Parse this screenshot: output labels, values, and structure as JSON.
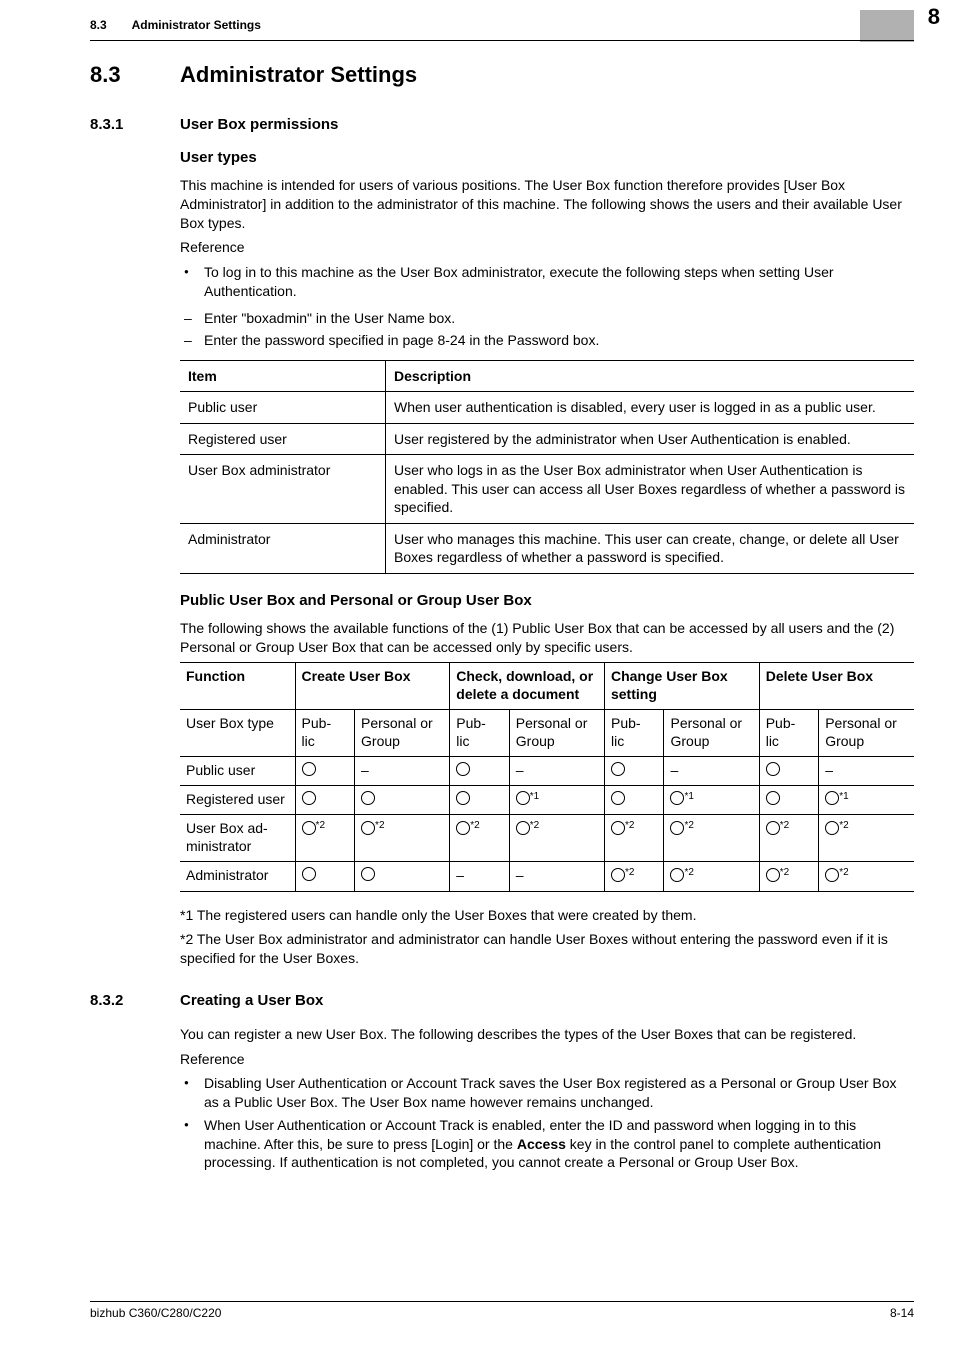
{
  "header": {
    "section_num": "8.3",
    "section_title": "Administrator Settings"
  },
  "chapter": "8",
  "h1": {
    "num": "8.3",
    "title": "Administrator Settings"
  },
  "s1": {
    "num": "8.3.1",
    "title": "User Box permissions",
    "h3a": "User types",
    "intro": "This machine is intended for users of various positions. The User Box function therefore provides [User Box Administrator] in addition to the administrator of this machine. The following shows the users and their available User Box types.",
    "ref_label": "Reference",
    "bullet1": "To log in to this machine as the User Box administrator, execute the following steps when setting User Authentication.",
    "dash1": "Enter \"boxadmin\" in the User Name box.",
    "dash2": "Enter the password specified in page 8-24 in the Password box.",
    "t1_head": {
      "c1": "Item",
      "c2": "Description"
    },
    "t1_rows": [
      {
        "c1": "Public user",
        "c2": "When user authentication is disabled, every user is logged in as a public user."
      },
      {
        "c1": "Registered user",
        "c2": "User registered by the administrator when User Authentication is enabled."
      },
      {
        "c1": "User Box administrator",
        "c2": "User who logs in as the User Box administrator when User Authentication is enabled. This user can access all User Boxes regardless of whether a password is specified."
      },
      {
        "c1": "Administrator",
        "c2": "User who manages this machine. This user can create, change, or delete all User Boxes regardless of whether a password is specified."
      }
    ],
    "h3b": "Public User Box and Personal or Group User Box",
    "p2": "The following shows the available functions of the (1) Public User Box that can be accessed by all users and the (2) Personal or Group User Box that can be accessed only by specific users.",
    "t2_head": {
      "f": "Function",
      "g1": "Create User Box",
      "g2": "Check, download, or delete a document",
      "g3": "Change User Box setting",
      "g4": "Delete User Box",
      "sub_a": "Public",
      "sub_b": "Personal or Group"
    },
    "t2_rows": [
      {
        "c0": "User Box type",
        "pub": "Public",
        "pg": "Personal or Group"
      },
      {
        "c0": "Public user"
      },
      {
        "c0": "Registered user"
      },
      {
        "c0": "User Box administrator"
      },
      {
        "c0": "Administrator"
      }
    ],
    "note1": "*1 The registered users can handle only the User Boxes that were created by them.",
    "note2": "*2 The User Box administrator and administrator can handle User Boxes without entering the password even if it is specified for the User Boxes."
  },
  "s2": {
    "num": "8.3.2",
    "title": "Creating a User Box",
    "p1": "You can register a new User Box. The following describes the types of the User Boxes that can be registered.",
    "ref_label": "Reference",
    "b1": "Disabling User Authentication or Account Track saves the User Box registered as a Personal or Group User Box as a Public User Box. The User Box name however remains unchanged.",
    "b2_a": "When User Authentication or Account Track is enabled, enter the ID and password when logging in to this machine. After this, be sure to press [Login] or the ",
    "b2_bold": "Access",
    "b2_b": " key in the control panel to complete authentication processing. If authentication is not completed, you cannot create a Personal or Group User Box."
  },
  "footer": {
    "left": "bizhub C360/C280/C220",
    "right": "8-14"
  }
}
